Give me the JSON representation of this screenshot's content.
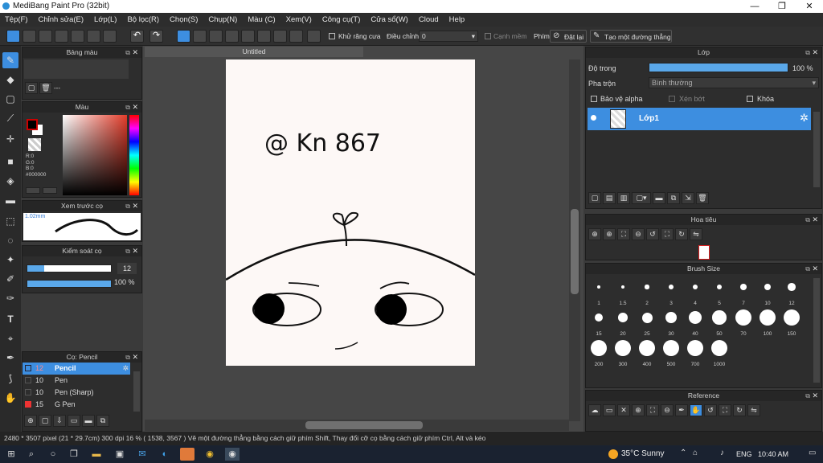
{
  "window": {
    "title": "MediBang Paint Pro (32bit)",
    "minimize": "—",
    "maximize": "❐",
    "close": "✕"
  },
  "menu": [
    "Tệp(F)",
    "Chỉnh sửa(E)",
    "Lớp(L)",
    "Bộ lọc(R)",
    "Chọn(S)",
    "Chụp(N)",
    "Màu (C)",
    "Xem(V)",
    "Công cụ(T)",
    "Cửa sổ(W)",
    "Cloud",
    "Help"
  ],
  "toolbar": {
    "antialias_label": "Khử răng cưa",
    "adjust_label": "Điều chỉnh",
    "adjust_value": "0",
    "smooth_label": "Cạnh mềm",
    "key_label": "Phím",
    "reset_label": "Đặt lại",
    "straight_line_label": "Tạo một đường thẳng"
  },
  "palette_panel": {
    "title": "Bảng màu",
    "bottom_text": "---"
  },
  "color_panel": {
    "title": "Màu",
    "r": "R:0",
    "g": "G:0",
    "b": "B:0",
    "hex": "#000000",
    "fg_color": "#000000",
    "bg_color": "#ffffff"
  },
  "brush_preview": {
    "title": "Xem trước cọ",
    "size": "1.02mm"
  },
  "brush_control": {
    "title": "Kiểm soát cọ",
    "size_value": "12",
    "opacity_value": "100 %",
    "size_fraction": 0.2,
    "opacity_fraction": 1.0
  },
  "brush_list": {
    "title": "Cọ: Pencil",
    "items": [
      {
        "size": "12",
        "name": "Pencil",
        "selected": true
      },
      {
        "size": "10",
        "name": "Pen",
        "selected": false
      },
      {
        "size": "10",
        "name": "Pen (Sharp)",
        "selected": false
      },
      {
        "size": "15",
        "name": "G Pen",
        "selected": false
      }
    ]
  },
  "document": {
    "tab": "Untitled",
    "drawing_text": "@ Kn 867"
  },
  "layer_panel": {
    "title": "Lớp",
    "opacity_label": "Độ trong",
    "opacity_value": "100 %",
    "blend_label": "Pha trộn",
    "blend_value": "Bình thường",
    "protect_alpha": "Bảo vệ alpha",
    "clipping": "Xén bớt",
    "lock": "Khóa",
    "layer_name": "Lớp1"
  },
  "navigator_panel": {
    "title": "Hoa tiêu"
  },
  "brush_size_panel": {
    "title": "Brush Size",
    "sizes": [
      "1",
      "1.5",
      "2",
      "3",
      "4",
      "5",
      "7",
      "10",
      "12",
      "15",
      "20",
      "25",
      "30",
      "40",
      "50",
      "70",
      "100",
      "150",
      "200",
      "300",
      "400",
      "500",
      "700",
      "1000"
    ]
  },
  "reference_panel": {
    "title": "Reference"
  },
  "status": {
    "text": "2480 * 3507 pixel   (21 * 29.7cm)   300 dpi   16 %   ( 1538, 3567 )   Vẽ một đường thẳng bằng cách giữ phím Shift, Thay đổi cỡ cọ bằng cách giữ phím Ctrl, Alt và kéo"
  },
  "taskbar": {
    "weather": "35°C  Sunny",
    "lang": "ENG",
    "time": "10:40 AM"
  }
}
